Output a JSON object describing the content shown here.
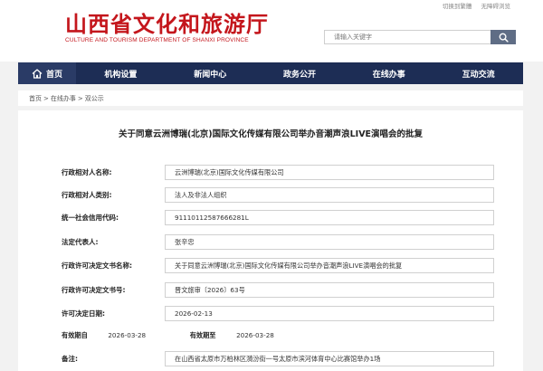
{
  "header": {
    "title": "山西省文化和旅游厅",
    "subtitle": "CULTURE AND TOURISM DEPARTMENT OF SHANXI PROVINCE",
    "top_links": [
      "切换到繁體",
      "无障碍浏览"
    ],
    "search_placeholder": "请输入关键字",
    "search_icon": "search-icon"
  },
  "nav": {
    "items": [
      "首页",
      "机构设置",
      "新闻中心",
      "政务公开",
      "在线办事",
      "互动交流"
    ],
    "home_icon": "home-icon"
  },
  "breadcrumb": [
    "首页",
    "在线办事",
    "双公示"
  ],
  "document": {
    "title": "关于同意云洲博瑞(北京)国际文化传媒有限公司举办音潮声浪LIVE演唱会的批复",
    "fields": [
      {
        "label": "行政相对人名称:",
        "value": "云洲博瑞(北京)国际文化传媒有限公司"
      },
      {
        "label": "行政相对人类别:",
        "value": "法人及非法人组织"
      },
      {
        "label": "统一社会信用代码:",
        "value": "91110112587666281L"
      },
      {
        "label": "法定代表人:",
        "value": "张辛忠"
      },
      {
        "label": "行政许可决定文书名称:",
        "value": "关于同意云洲博瑞(北京)国际文化传媒有限公司举办音潮声浪LIVE演唱会的批复"
      },
      {
        "label": "行政许可决定文书号:",
        "value": "晋文旅审〔2026〕63号"
      },
      {
        "label": "许可决定日期:",
        "value": "2026-02-13"
      }
    ],
    "period": {
      "from_label": "有效期自",
      "from": "2026-03-28",
      "to_label": "有效期至",
      "to": "2026-03-28"
    },
    "remark": {
      "label": "备注:",
      "value": "在山西省太原市万柏林区漪汾街一号太原市滨河体育中心比赛馆举办1场"
    }
  }
}
